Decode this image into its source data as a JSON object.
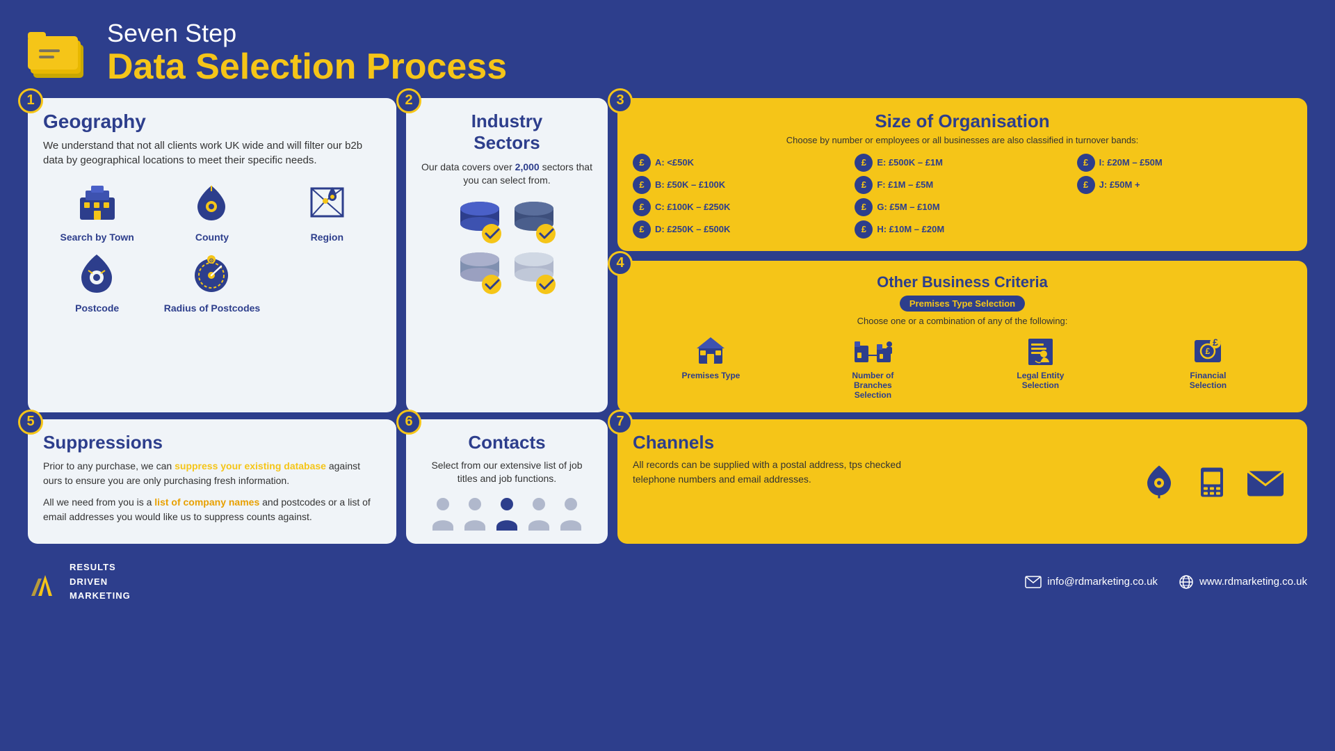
{
  "header": {
    "subtitle": "Seven Step",
    "title": "Data Selection Process"
  },
  "steps": {
    "step1": {
      "number": "1",
      "title": "Geography",
      "description": "We understand that not all clients work UK wide and will filter our b2b data by geographical locations to meet their specific needs.",
      "icons": [
        {
          "label": "Search by Town",
          "type": "town"
        },
        {
          "label": "County",
          "type": "county"
        },
        {
          "label": "Region",
          "type": "region"
        },
        {
          "label": "Postcode",
          "type": "postcode"
        },
        {
          "label": "Radius of Postcodes",
          "type": "radius"
        }
      ]
    },
    "step2": {
      "number": "2",
      "title": "Industry Sectors",
      "description": "Our data covers over 2,000 sectors that you can select from.",
      "highlight": "2,000"
    },
    "step3": {
      "number": "3",
      "title": "Size of Organisation",
      "subtitle": "Choose by number or employees or all businesses are also classified in turnover bands:",
      "bands": [
        {
          "label": "A: <£50K"
        },
        {
          "label": "E: £500K – £1M"
        },
        {
          "label": "I: £20M – £50M"
        },
        {
          "label": "B: £50K – £100K"
        },
        {
          "label": "F: £1M – £5M"
        },
        {
          "label": "J: £50M +"
        },
        {
          "label": "C: £100K – £250K"
        },
        {
          "label": "G: £5M – £10M"
        },
        {
          "label": ""
        },
        {
          "label": "D: £250K – £500K"
        },
        {
          "label": "H: £10M – £20M"
        },
        {
          "label": ""
        }
      ]
    },
    "step4": {
      "number": "4",
      "title": "Other Business Criteria",
      "badge": "Premises Type Selection",
      "subtitle": "Choose one or a combination of any of the following:",
      "icons": [
        {
          "label": "Premises Type"
        },
        {
          "label": "Number of Branches Selection"
        },
        {
          "label": "Legal Entity Selection"
        },
        {
          "label": "Financial Selection"
        }
      ]
    },
    "step5": {
      "number": "5",
      "title": "Suppressions",
      "para1": "Prior to any purchase, we can suppress your existing database against ours to ensure you are only purchasing fresh information.",
      "para2_before": "All we need from you is a ",
      "para2_link": "list of company names",
      "para2_after": " and postcodes or a list of email addresses you would like us to suppress counts against.",
      "highlight1": "suppress your existing database"
    },
    "step6": {
      "number": "6",
      "title": "Contacts",
      "description": "Select from our extensive list of job titles and job functions."
    },
    "step7": {
      "number": "7",
      "title": "Channels",
      "description": "All records can be supplied with a postal address, tps checked telephone numbers and email addresses."
    }
  },
  "footer": {
    "logo_lines": [
      "RESULTS",
      "DRIVEN",
      "MARKETING"
    ],
    "email_icon": "✉",
    "email": "info@rdmarketing.co.uk",
    "globe_icon": "🌐",
    "website": "www.rdmarketing.co.uk"
  }
}
